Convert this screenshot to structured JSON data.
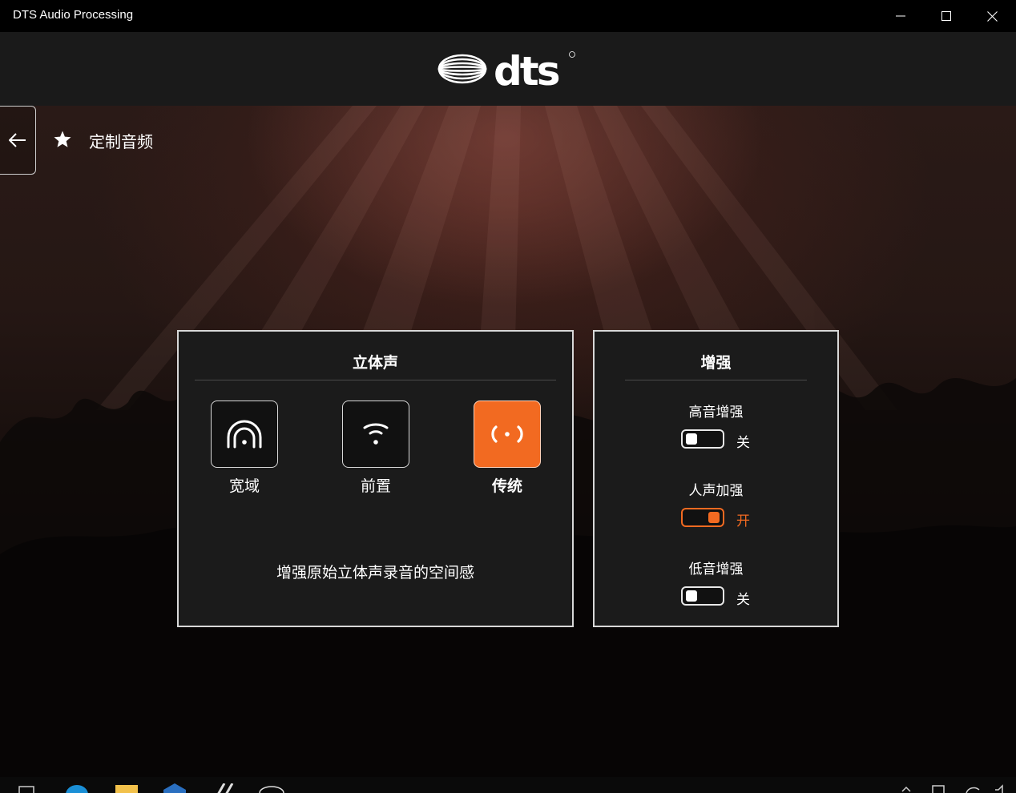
{
  "window": {
    "title": "DTS Audio Processing",
    "controls": [
      "minimize",
      "maximize",
      "close"
    ]
  },
  "header": {
    "logo_text": "dts"
  },
  "nav": {
    "back_icon": "arrow-left-icon",
    "page_icon": "star-icon",
    "page_title": "定制音频"
  },
  "stereo_panel": {
    "title": "立体声",
    "modes": [
      {
        "label": "宽域",
        "icon": "headphones-wide-icon",
        "selected": false
      },
      {
        "label": "前置",
        "icon": "front-speaker-icon",
        "selected": false
      },
      {
        "label": "传统",
        "icon": "stereo-traditional-icon",
        "selected": true
      }
    ],
    "description": "增强原始立体声录音的空间感"
  },
  "enhance_panel": {
    "title": "增强",
    "toggles": [
      {
        "label": "高音增强",
        "state_text": "关",
        "on": false
      },
      {
        "label": "人声加强",
        "state_text": "开",
        "on": true
      },
      {
        "label": "低音增强",
        "state_text": "关",
        "on": false
      }
    ]
  },
  "colors": {
    "accent": "#f26a21",
    "panel_bg": "#1b1b1b",
    "header_bg": "#1a1a1a",
    "titlebar_bg": "#000000"
  }
}
